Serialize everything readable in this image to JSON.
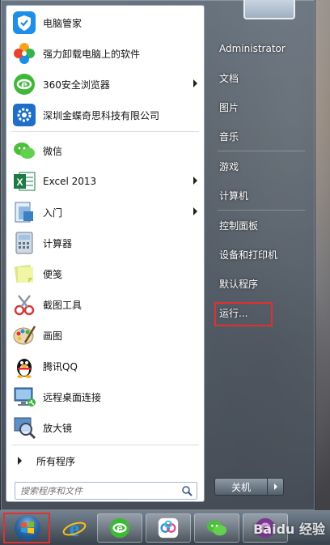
{
  "programs": [
    {
      "label": "电脑管家",
      "icon": "tencent-pc-manager-icon",
      "submenu": false
    },
    {
      "label": "强力卸载电脑上的软件",
      "icon": "uninstaller-flower-icon",
      "submenu": false
    },
    {
      "label": "360安全浏览器",
      "icon": "360-browser-icon",
      "submenu": true
    },
    {
      "label": "深圳金蝶奇思科技有限公司",
      "icon": "kingdee-settings-icon",
      "submenu": false
    },
    {
      "label": "微信",
      "icon": "wechat-icon",
      "submenu": false
    },
    {
      "label": "Excel 2013",
      "icon": "excel-icon",
      "submenu": true
    },
    {
      "label": "入门",
      "icon": "getting-started-icon",
      "submenu": true
    },
    {
      "label": "计算器",
      "icon": "calculator-icon",
      "submenu": false
    },
    {
      "label": "便笺",
      "icon": "sticky-notes-icon",
      "submenu": false
    },
    {
      "label": "截图工具",
      "icon": "snipping-tool-icon",
      "submenu": false
    },
    {
      "label": "画图",
      "icon": "paint-icon",
      "submenu": false
    },
    {
      "label": "腾讯QQ",
      "icon": "qq-penguin-icon",
      "submenu": false
    },
    {
      "label": "远程桌面连接",
      "icon": "remote-desktop-icon",
      "submenu": false
    },
    {
      "label": "放大镜",
      "icon": "magnifier-icon",
      "submenu": false
    }
  ],
  "all_programs_label": "所有程序",
  "search": {
    "placeholder": "搜索程序和文件",
    "icon": "search-icon"
  },
  "right_pane": {
    "user": "Administrator",
    "items": [
      "文档",
      "图片",
      "音乐",
      "游戏",
      "计算机",
      "控制面板",
      "设备和打印机",
      "默认程序",
      "运行..."
    ],
    "highlighted": "运行..."
  },
  "shutdown_label": "关机",
  "taskbar": {
    "items": [
      "start-orb-icon",
      "ie-icon",
      "360-browser-icon",
      "baidu-netdisk-icon",
      "wechat-icon",
      "media-icon"
    ],
    "start_highlighted": true
  },
  "watermark": "Baidu 经验",
  "colors": {
    "highlight_box": "#e13030",
    "pane_bg": "#ffffff"
  }
}
